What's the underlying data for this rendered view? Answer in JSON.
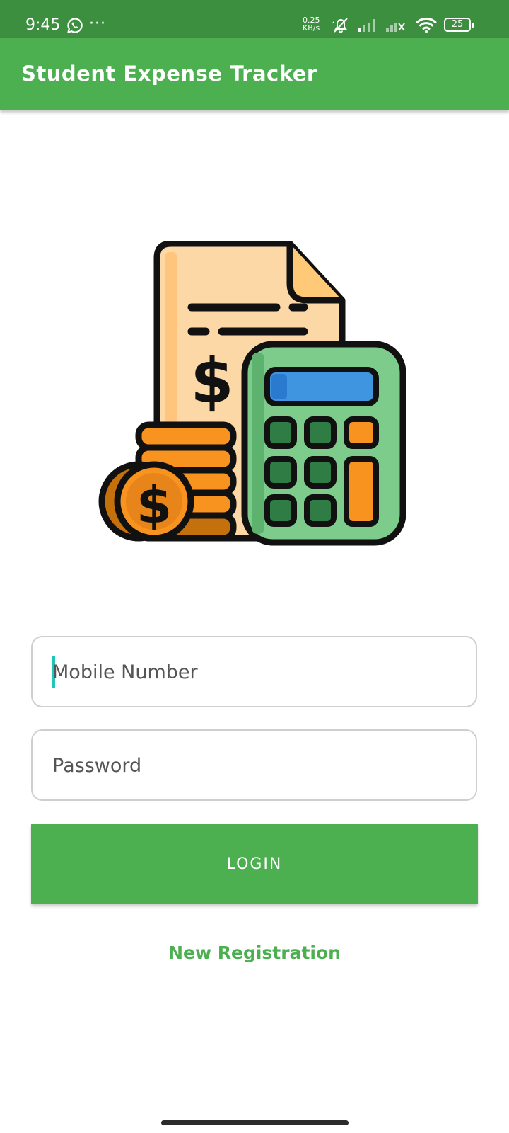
{
  "status_bar": {
    "time": "9:45",
    "more_indicator": "···",
    "net_speed_value": "0.25",
    "net_speed_unit": "KB/s",
    "battery_level": "25",
    "background_color": "#3c8f3f",
    "icons": [
      "whatsapp-icon",
      "more-icon",
      "muted-bell-icon",
      "cellular-signal-icon",
      "cellular-signal-no-service-icon",
      "wifi-icon",
      "battery-icon"
    ]
  },
  "app_bar": {
    "title": "Student Expense Tracker",
    "background_color": "#4caf50"
  },
  "illustration": {
    "icon": "expense-calculator-illustration"
  },
  "form": {
    "mobile_number": {
      "placeholder": "Mobile Number",
      "value": ""
    },
    "password": {
      "placeholder": "Password",
      "value": ""
    },
    "login_label": "LOGIN",
    "new_registration_label": "New Registration"
  },
  "colors": {
    "accent": "#4caf50",
    "cursor": "#1ec8b8"
  }
}
